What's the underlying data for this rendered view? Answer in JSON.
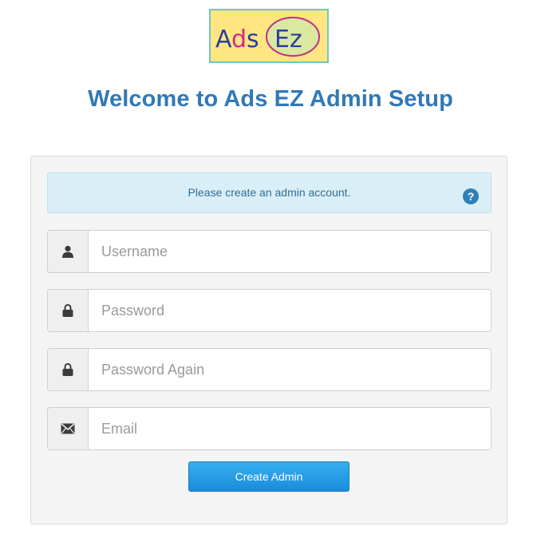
{
  "logo": {
    "text_left": "Ads",
    "text_right": "Ez"
  },
  "header": {
    "title": "Welcome to Ads EZ Admin Setup"
  },
  "alert": {
    "message": "Please create an admin account.",
    "help_glyph": "?"
  },
  "form": {
    "fields": [
      {
        "name": "username",
        "placeholder": "Username",
        "icon": "user-icon",
        "value": ""
      },
      {
        "name": "password",
        "placeholder": "Password",
        "icon": "lock-icon",
        "value": ""
      },
      {
        "name": "password_again",
        "placeholder": "Password Again",
        "icon": "lock-icon",
        "value": ""
      },
      {
        "name": "email",
        "placeholder": "Email",
        "icon": "envelope-icon",
        "value": ""
      }
    ],
    "submit_label": "Create Admin"
  },
  "colors": {
    "title": "#3179b6",
    "alert_bg": "#daeef8",
    "alert_text": "#2f6f95",
    "button": "#1a8cdb",
    "logo_bg": "#ffe680",
    "logo_border": "#6fc7c0"
  }
}
